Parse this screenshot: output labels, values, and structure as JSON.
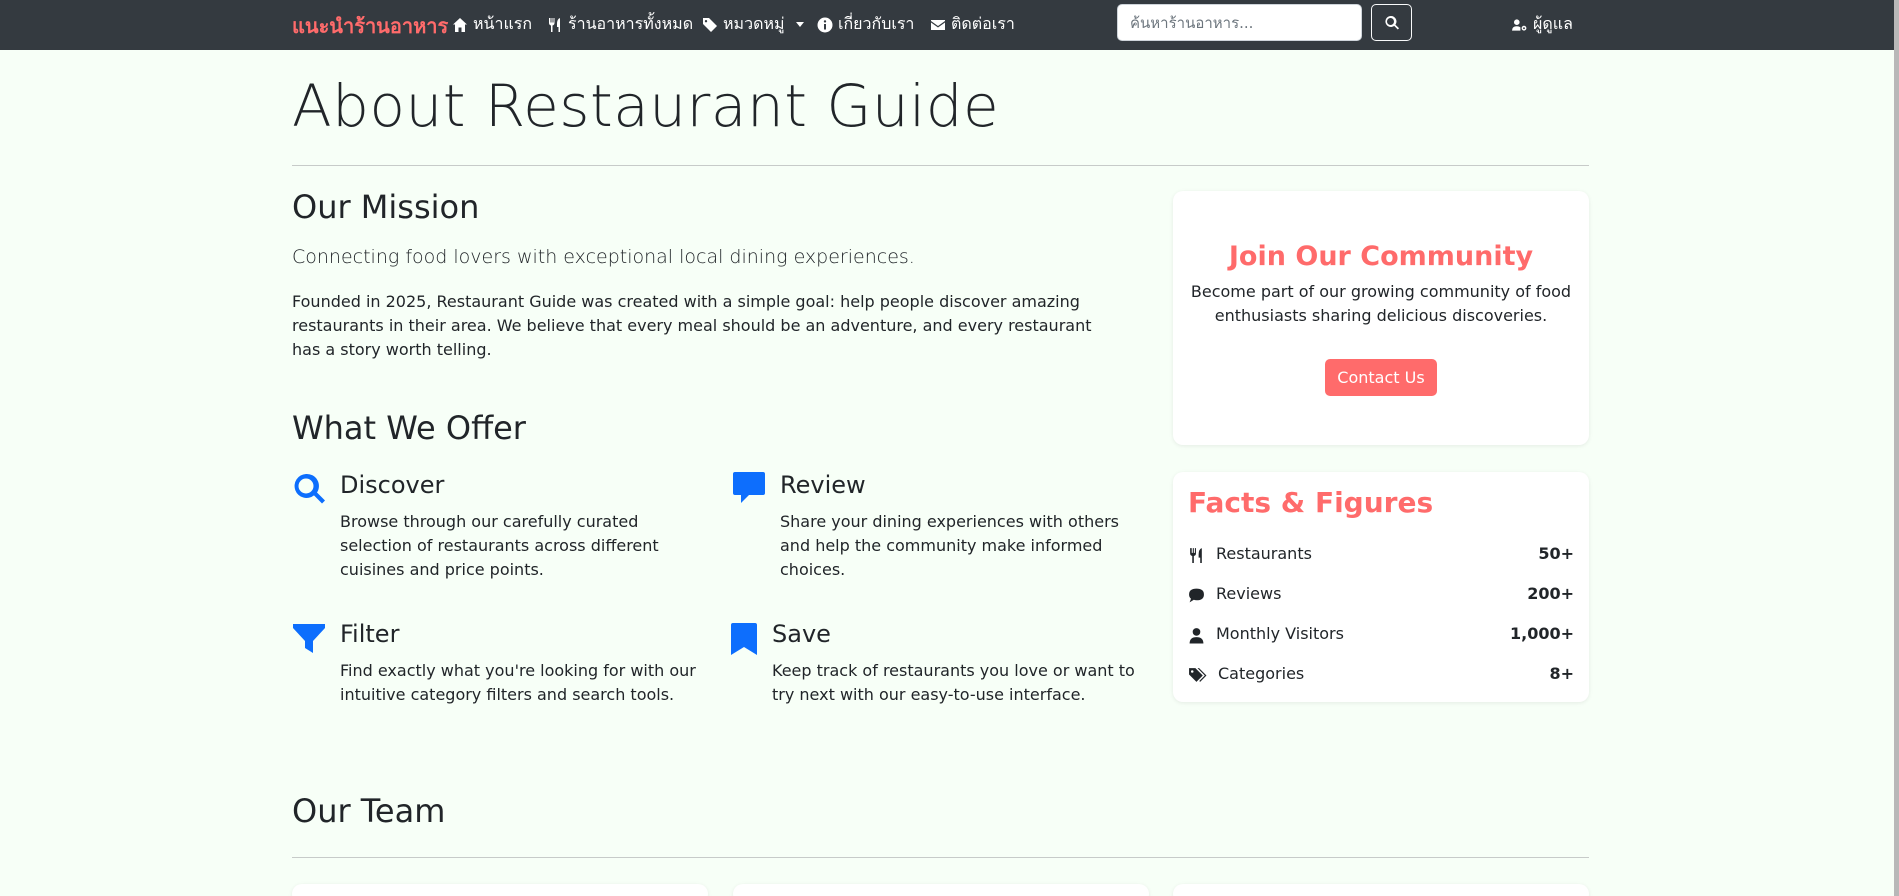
{
  "navbar": {
    "brand": "แนะนำร้านอาหาร",
    "links": [
      {
        "label": "หน้าแรก",
        "icon": "home-icon"
      },
      {
        "label": "ร้านอาหารทั้งหมด",
        "icon": "utensils-icon"
      },
      {
        "label": "หมวดหมู่",
        "icon": "tags-icon",
        "dropdown": true
      },
      {
        "label": "เกี่ยวกับเรา",
        "icon": "info-circle-icon"
      },
      {
        "label": "ติดต่อเรา",
        "icon": "envelope-icon"
      }
    ],
    "search": {
      "placeholder": "ค้นหาร้านอาหาร...",
      "value": ""
    },
    "admin_label": "ผู้ดูแล"
  },
  "page": {
    "title": "About Restaurant Guide",
    "mission": {
      "heading": "Our Mission",
      "lead": "Connecting food lovers with exceptional local dining experiences.",
      "body": "Founded in 2025, Restaurant Guide was created with a simple goal: help people discover amazing restaurants in their area. We believe that every meal should be an adventure, and every restaurant has a story worth telling."
    },
    "offer": {
      "heading": "What We Offer",
      "features": [
        {
          "title": "Discover",
          "text": "Browse through our carefully curated selection of restaurants across different cuisines and price points.",
          "icon": "search-icon"
        },
        {
          "title": "Review",
          "text": "Share your dining experiences with others and help the community make informed choices.",
          "icon": "comment-icon"
        },
        {
          "title": "Filter",
          "text": "Find exactly what you're looking for with our intuitive category filters and search tools.",
          "icon": "filter-icon"
        },
        {
          "title": "Save",
          "text": "Keep track of restaurants you love or want to try next with our easy-to-use interface.",
          "icon": "bookmark-icon"
        }
      ]
    },
    "team": {
      "heading": "Our Team"
    }
  },
  "sidebar": {
    "join": {
      "title": "Join Our Community",
      "text": "Become part of our growing community of food enthusiasts sharing delicious discoveries.",
      "button": "Contact Us"
    },
    "facts": {
      "title": "Facts & Figures",
      "rows": [
        {
          "label": "Restaurants",
          "value": "50+",
          "icon": "utensils-icon"
        },
        {
          "label": "Reviews",
          "value": "200+",
          "icon": "comment-icon"
        },
        {
          "label": "Monthly Visitors",
          "value": "1,000+",
          "icon": "user-icon"
        },
        {
          "label": "Categories",
          "value": "8+",
          "icon": "tags-icon"
        }
      ]
    }
  },
  "colors": {
    "navbar": "#343a40",
    "accent": "#ff6b6b",
    "icon_blue": "#0d6efd",
    "page_bg": "#f7fff7"
  }
}
